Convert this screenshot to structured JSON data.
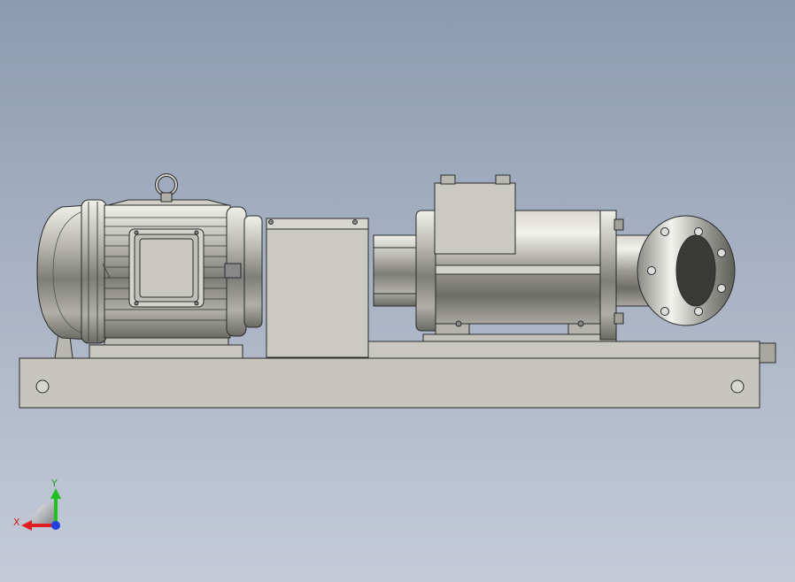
{
  "triad": {
    "x_label": "X",
    "y_label": "Y",
    "x_color": "#e02020",
    "y_color": "#20c020",
    "z_color": "#2040e0"
  },
  "colors": {
    "background_top": "#8c9bb0",
    "background_bottom": "#c4cad8",
    "part_fill": "#c8c8c0",
    "outline": "#2a2a2a"
  }
}
